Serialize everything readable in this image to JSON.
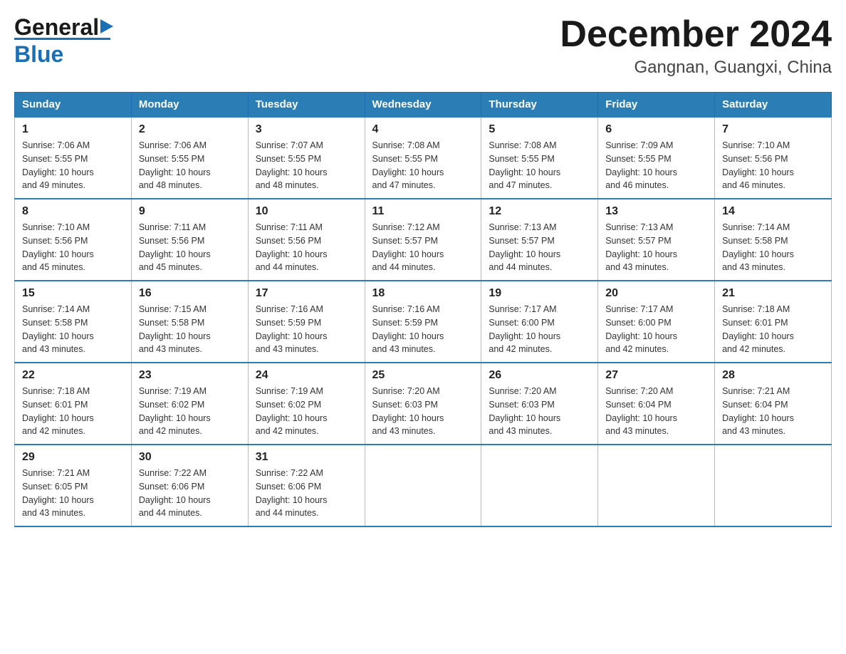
{
  "logo": {
    "general": "General",
    "blue": "Blue",
    "triangle": "▶"
  },
  "title": {
    "month_year": "December 2024",
    "location": "Gangnan, Guangxi, China"
  },
  "headers": [
    "Sunday",
    "Monday",
    "Tuesday",
    "Wednesday",
    "Thursday",
    "Friday",
    "Saturday"
  ],
  "weeks": [
    [
      {
        "day": "1",
        "info": "Sunrise: 7:06 AM\nSunset: 5:55 PM\nDaylight: 10 hours\nand 49 minutes."
      },
      {
        "day": "2",
        "info": "Sunrise: 7:06 AM\nSunset: 5:55 PM\nDaylight: 10 hours\nand 48 minutes."
      },
      {
        "day": "3",
        "info": "Sunrise: 7:07 AM\nSunset: 5:55 PM\nDaylight: 10 hours\nand 48 minutes."
      },
      {
        "day": "4",
        "info": "Sunrise: 7:08 AM\nSunset: 5:55 PM\nDaylight: 10 hours\nand 47 minutes."
      },
      {
        "day": "5",
        "info": "Sunrise: 7:08 AM\nSunset: 5:55 PM\nDaylight: 10 hours\nand 47 minutes."
      },
      {
        "day": "6",
        "info": "Sunrise: 7:09 AM\nSunset: 5:55 PM\nDaylight: 10 hours\nand 46 minutes."
      },
      {
        "day": "7",
        "info": "Sunrise: 7:10 AM\nSunset: 5:56 PM\nDaylight: 10 hours\nand 46 minutes."
      }
    ],
    [
      {
        "day": "8",
        "info": "Sunrise: 7:10 AM\nSunset: 5:56 PM\nDaylight: 10 hours\nand 45 minutes."
      },
      {
        "day": "9",
        "info": "Sunrise: 7:11 AM\nSunset: 5:56 PM\nDaylight: 10 hours\nand 45 minutes."
      },
      {
        "day": "10",
        "info": "Sunrise: 7:11 AM\nSunset: 5:56 PM\nDaylight: 10 hours\nand 44 minutes."
      },
      {
        "day": "11",
        "info": "Sunrise: 7:12 AM\nSunset: 5:57 PM\nDaylight: 10 hours\nand 44 minutes."
      },
      {
        "day": "12",
        "info": "Sunrise: 7:13 AM\nSunset: 5:57 PM\nDaylight: 10 hours\nand 44 minutes."
      },
      {
        "day": "13",
        "info": "Sunrise: 7:13 AM\nSunset: 5:57 PM\nDaylight: 10 hours\nand 43 minutes."
      },
      {
        "day": "14",
        "info": "Sunrise: 7:14 AM\nSunset: 5:58 PM\nDaylight: 10 hours\nand 43 minutes."
      }
    ],
    [
      {
        "day": "15",
        "info": "Sunrise: 7:14 AM\nSunset: 5:58 PM\nDaylight: 10 hours\nand 43 minutes."
      },
      {
        "day": "16",
        "info": "Sunrise: 7:15 AM\nSunset: 5:58 PM\nDaylight: 10 hours\nand 43 minutes."
      },
      {
        "day": "17",
        "info": "Sunrise: 7:16 AM\nSunset: 5:59 PM\nDaylight: 10 hours\nand 43 minutes."
      },
      {
        "day": "18",
        "info": "Sunrise: 7:16 AM\nSunset: 5:59 PM\nDaylight: 10 hours\nand 43 minutes."
      },
      {
        "day": "19",
        "info": "Sunrise: 7:17 AM\nSunset: 6:00 PM\nDaylight: 10 hours\nand 42 minutes."
      },
      {
        "day": "20",
        "info": "Sunrise: 7:17 AM\nSunset: 6:00 PM\nDaylight: 10 hours\nand 42 minutes."
      },
      {
        "day": "21",
        "info": "Sunrise: 7:18 AM\nSunset: 6:01 PM\nDaylight: 10 hours\nand 42 minutes."
      }
    ],
    [
      {
        "day": "22",
        "info": "Sunrise: 7:18 AM\nSunset: 6:01 PM\nDaylight: 10 hours\nand 42 minutes."
      },
      {
        "day": "23",
        "info": "Sunrise: 7:19 AM\nSunset: 6:02 PM\nDaylight: 10 hours\nand 42 minutes."
      },
      {
        "day": "24",
        "info": "Sunrise: 7:19 AM\nSunset: 6:02 PM\nDaylight: 10 hours\nand 42 minutes."
      },
      {
        "day": "25",
        "info": "Sunrise: 7:20 AM\nSunset: 6:03 PM\nDaylight: 10 hours\nand 43 minutes."
      },
      {
        "day": "26",
        "info": "Sunrise: 7:20 AM\nSunset: 6:03 PM\nDaylight: 10 hours\nand 43 minutes."
      },
      {
        "day": "27",
        "info": "Sunrise: 7:20 AM\nSunset: 6:04 PM\nDaylight: 10 hours\nand 43 minutes."
      },
      {
        "day": "28",
        "info": "Sunrise: 7:21 AM\nSunset: 6:04 PM\nDaylight: 10 hours\nand 43 minutes."
      }
    ],
    [
      {
        "day": "29",
        "info": "Sunrise: 7:21 AM\nSunset: 6:05 PM\nDaylight: 10 hours\nand 43 minutes."
      },
      {
        "day": "30",
        "info": "Sunrise: 7:22 AM\nSunset: 6:06 PM\nDaylight: 10 hours\nand 44 minutes."
      },
      {
        "day": "31",
        "info": "Sunrise: 7:22 AM\nSunset: 6:06 PM\nDaylight: 10 hours\nand 44 minutes."
      },
      {
        "day": "",
        "info": ""
      },
      {
        "day": "",
        "info": ""
      },
      {
        "day": "",
        "info": ""
      },
      {
        "day": "",
        "info": ""
      }
    ]
  ]
}
